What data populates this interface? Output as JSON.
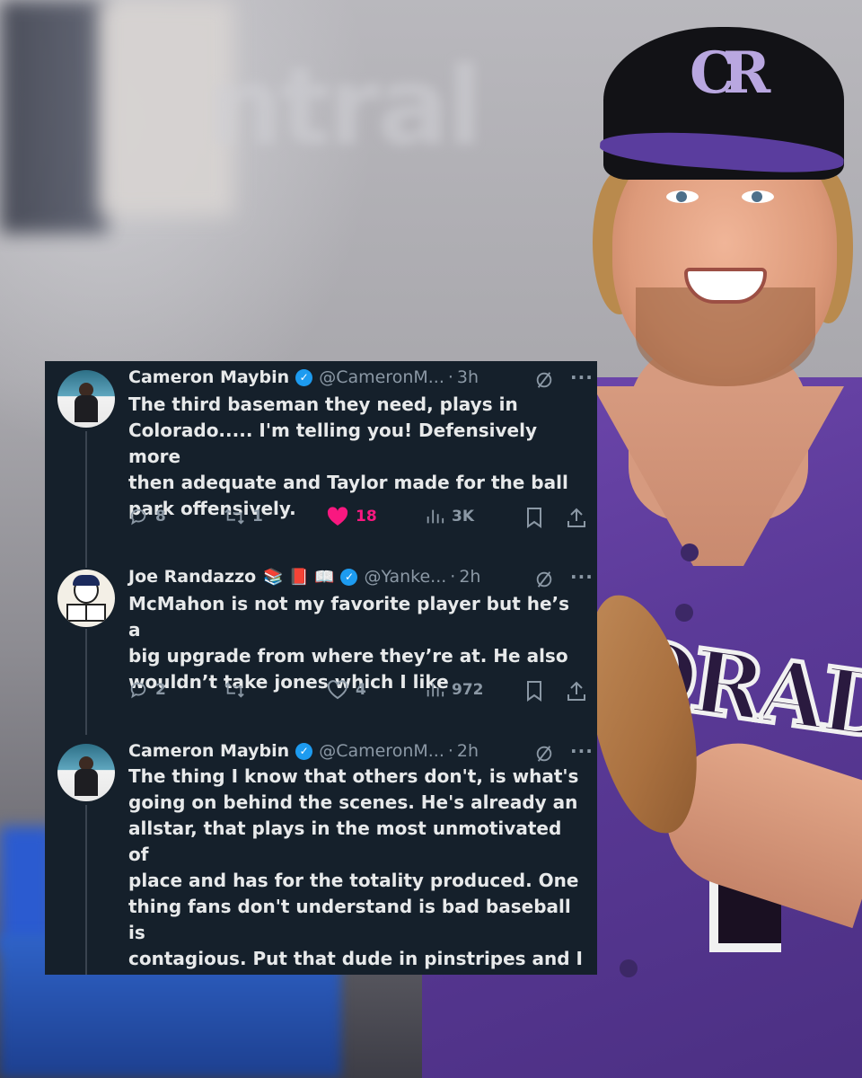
{
  "background": {
    "cap_logo": "CR",
    "jersey_text": "ORADO"
  },
  "colors": {
    "card_bg": "#15202b",
    "text": "#e7e9ea",
    "muted": "#8b98a5",
    "verified": "#1d9bf0",
    "like": "#f91880"
  },
  "tweets": [
    {
      "name": "Cameron Maybin",
      "emojis": [],
      "verified_icon": "verified-badge-icon",
      "handle": "@CameronM...",
      "separator": "·",
      "time": "3h",
      "text": "The third baseman they need, plays  in\nColorado..... I'm telling you! Defensively more\nthen adequate and Taylor made for the ball\npark offensively.",
      "actions": {
        "replies": "8",
        "reposts": "1",
        "likes": "18",
        "liked": true,
        "views": "3K"
      }
    },
    {
      "name": "Joe Randazzo",
      "emojis": [
        "📚",
        "📕",
        "📖"
      ],
      "verified_icon": "verified-badge-icon",
      "handle": "@Yanke...",
      "separator": "·",
      "time": "2h",
      "text": "McMahon is not my favorite player but he’s a\nbig upgrade from where they’re at. He also\nwouldn’t take jones which I like",
      "actions": {
        "replies": "2",
        "reposts": "",
        "likes": "4",
        "liked": false,
        "views": "972"
      }
    },
    {
      "name": "Cameron Maybin",
      "emojis": [],
      "verified_icon": "verified-badge-icon",
      "handle": "@CameronM...",
      "separator": "·",
      "time": "2h",
      "text": "The thing I know that others don't, is what's\ngoing on behind the scenes. He's already an\nallstar, that plays in the most unmotivated of\nplace and has for the totality produced. One\nthing fans don't understand is bad baseball is\ncontagious. Put that dude in pinstripes and I\ncan't wait to watch you say how much you\nlove him lol.."
    }
  ]
}
